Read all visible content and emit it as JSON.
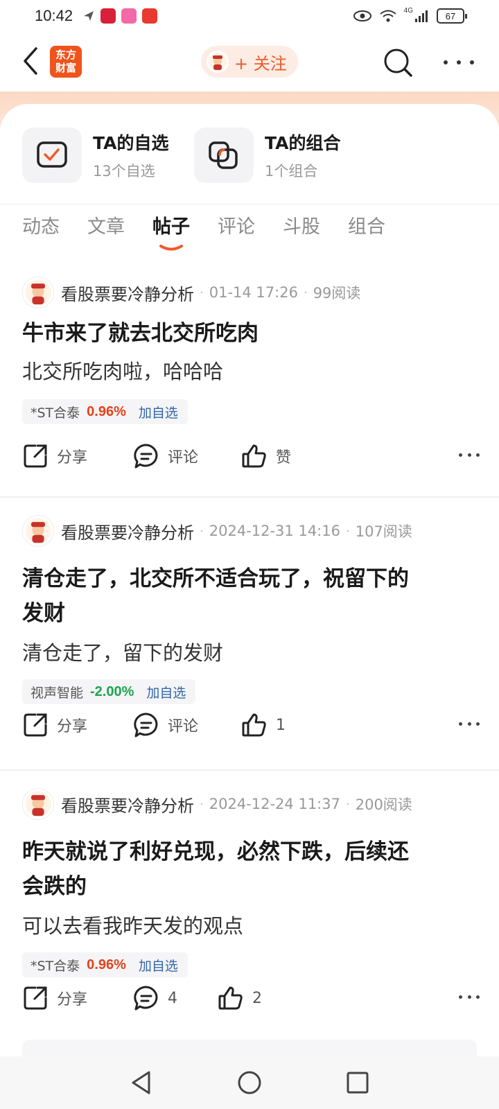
{
  "status_bar": {
    "time": "10:42",
    "network": "4G",
    "battery": "67"
  },
  "header": {
    "brand_logo_text": "东方财富",
    "follow_label": "+ 关注"
  },
  "shortcuts": [
    {
      "title": "TA的自选",
      "subtitle": "13个自选",
      "icon": "checkbox-icon"
    },
    {
      "title": "TA的组合",
      "subtitle": "1个组合",
      "icon": "overlap-squares-icon"
    }
  ],
  "tabs": [
    {
      "label": "动态",
      "active": false
    },
    {
      "label": "文章",
      "active": false
    },
    {
      "label": "帖子",
      "active": true
    },
    {
      "label": "评论",
      "active": false
    },
    {
      "label": "斗股",
      "active": false
    },
    {
      "label": "组合",
      "active": false
    }
  ],
  "posts": [
    {
      "author": "看股票要冷静分析",
      "time": "01-14 17:26",
      "reads": "99阅读",
      "title": "牛市来了就去北交所吃肉",
      "body": "北交所吃肉啦，哈哈哈",
      "stock": {
        "name": "*ST合泰",
        "change": "0.96%",
        "direction": "up",
        "add": "加自选"
      },
      "share": "分享",
      "comment": "评论",
      "like": "赞"
    },
    {
      "author": "看股票要冷静分析",
      "time": "2024-12-31 14:16",
      "reads": "107阅读",
      "title_line1": "清仓走了，北交所不适合玩了，祝留下的",
      "title_line2": "发财",
      "body": "清仓走了，留下的发财",
      "stock": {
        "name": "视声智能",
        "change": "-2.00%",
        "direction": "down",
        "add": "加自选"
      },
      "share": "分享",
      "comment": "评论",
      "like": "1"
    },
    {
      "author": "看股票要冷静分析",
      "time": "2024-12-24 11:37",
      "reads": "200阅读",
      "title_line1": "昨天就说了利好兑现，必然下跌，后续还",
      "title_line2": "会跌的",
      "body": "可以去看我昨天发的观点",
      "stock": {
        "name": "*ST合泰",
        "change": "0.96%",
        "direction": "up",
        "add": "加自选"
      },
      "share": "分享",
      "comment": "4",
      "like": "2"
    }
  ],
  "colors": {
    "accent": "#f05a28",
    "up": "#e2421b",
    "down": "#1aa550",
    "link": "#3366a8"
  }
}
